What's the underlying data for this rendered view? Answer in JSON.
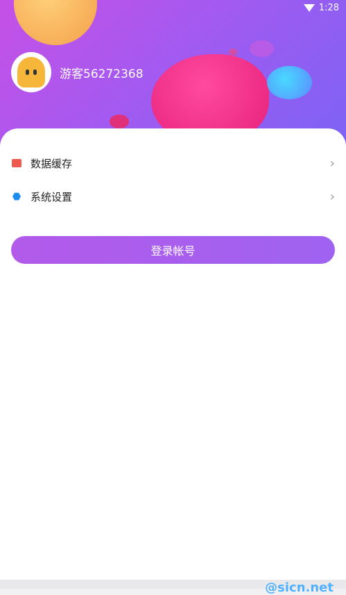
{
  "status_bar": {
    "time": "1:28"
  },
  "profile": {
    "username": "游客56272368"
  },
  "menu": [
    {
      "label": "数据缓存",
      "icon": "broom-icon"
    },
    {
      "label": "系统设置",
      "icon": "hexagon-settings-icon"
    }
  ],
  "login_button": {
    "label": "登录帐号"
  },
  "watermark": "@sicn.net",
  "colors": {
    "accent": "#a35af0",
    "card": "#ffffff",
    "hero_pink": "#e6207a"
  }
}
